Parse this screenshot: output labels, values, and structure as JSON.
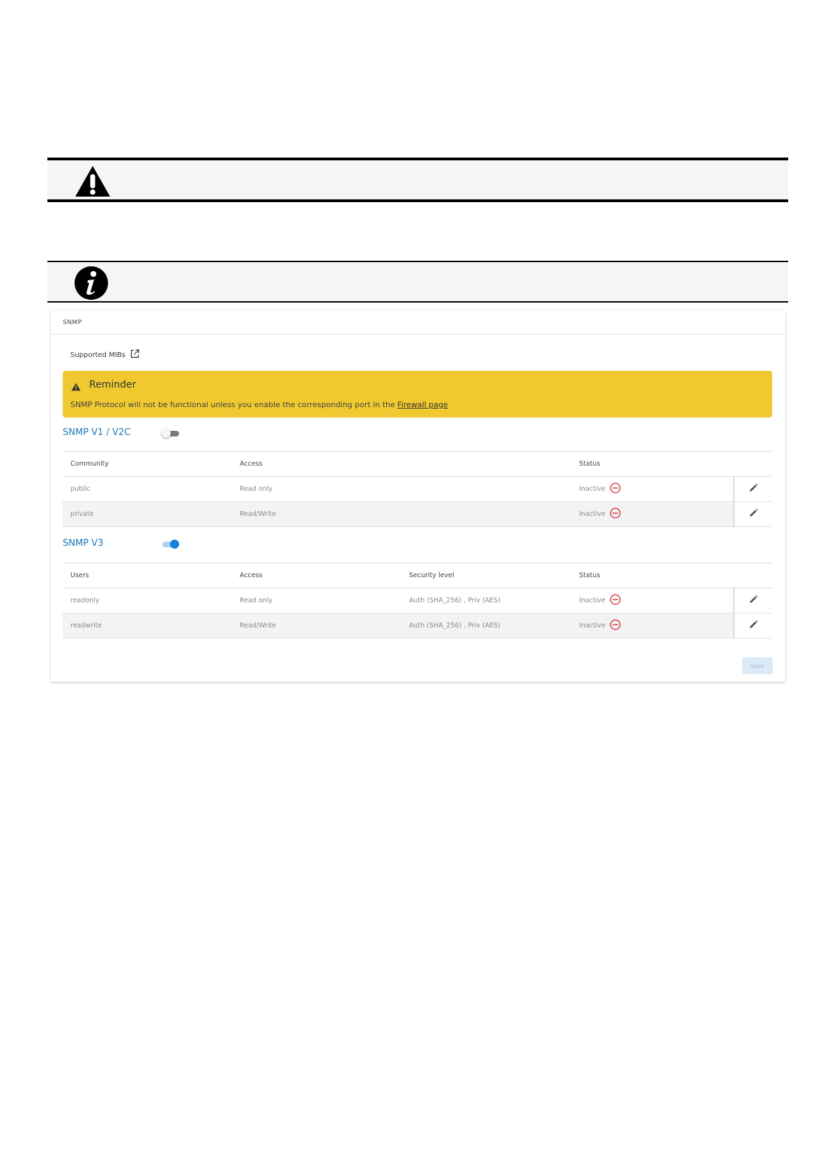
{
  "admonitions": [
    {
      "type": "warning",
      "icon": "warning-triangle-icon"
    },
    {
      "type": "info",
      "icon": "info-circle-icon"
    }
  ],
  "panel": {
    "title": "SNMP",
    "mibs_link": "Supported MIBs",
    "mibs_icon": "external-link-icon",
    "reminder": {
      "title": "Reminder",
      "text": "SNMP Protocol will not be functional unless you enable the corresponding port in the ",
      "link": "Firewall page",
      "color": "#f0c930"
    },
    "v1v2c": {
      "title": "SNMP V1 / V2C",
      "enabled": false,
      "headers": [
        "Community",
        "Access",
        "Status"
      ],
      "rows": [
        {
          "community": "public",
          "access": "Read only",
          "status": "Inactive"
        },
        {
          "community": "private",
          "access": "Read/Write",
          "status": "Inactive"
        }
      ]
    },
    "v3": {
      "title": "SNMP V3",
      "enabled": true,
      "headers": [
        "Users",
        "Access",
        "Security level",
        "Status"
      ],
      "rows": [
        {
          "user": "readonly",
          "access": "Read only",
          "security": "Auth (SHA_256) , Priv (AES)",
          "status": "Inactive"
        },
        {
          "user": "readwrite",
          "access": "Read/Write",
          "security": "Auth (SHA_256) , Priv (AES)",
          "status": "Inactive"
        }
      ]
    },
    "save_label": "Save",
    "colors": {
      "accent": "#1e78b8",
      "toggle_on": "#1a7fe0",
      "inactive": "#d0343a"
    }
  }
}
